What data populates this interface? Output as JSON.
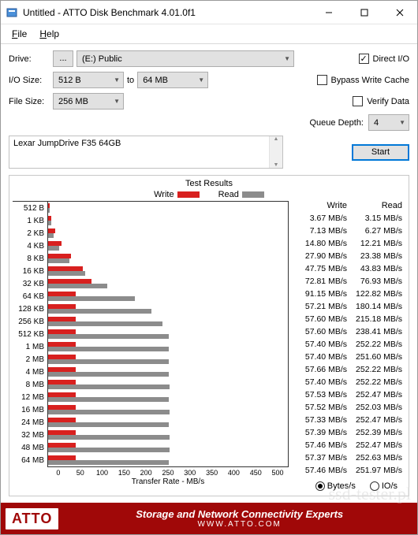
{
  "window": {
    "title": "Untitled - ATTO Disk Benchmark 4.01.0f1"
  },
  "menu": {
    "file": "File",
    "help": "Help"
  },
  "labels": {
    "drive": "Drive:",
    "iosize": "I/O Size:",
    "filesize": "File Size:",
    "to": "to",
    "queue_depth": "Queue Depth:",
    "direct_io": "Direct I/O",
    "bypass_cache": "Bypass Write Cache",
    "verify_data": "Verify Data",
    "start": "Start",
    "test_results": "Test Results",
    "write": "Write",
    "read": "Read",
    "xfer": "Transfer Rate - MB/s",
    "bytes_s": "Bytes/s",
    "io_s": "IO/s"
  },
  "form": {
    "drive_browse": "...",
    "drive_value": "(E:) Public",
    "io_min": "512 B",
    "io_max": "64 MB",
    "file_size": "256 MB",
    "queue_depth": "4",
    "direct_io_checked": true,
    "bypass_checked": false,
    "verify_checked": false,
    "description": "Lexar JumpDrive F35 64GB"
  },
  "chart_data": {
    "type": "bar",
    "title": "Test Results",
    "xlabel": "Transfer Rate - MB/s",
    "ylabel": "",
    "xlim": [
      0,
      500
    ],
    "xticks": [
      0,
      50,
      100,
      150,
      200,
      250,
      300,
      350,
      400,
      450,
      500
    ],
    "categories": [
      "512 B",
      "1 KB",
      "2 KB",
      "4 KB",
      "8 KB",
      "16 KB",
      "32 KB",
      "64 KB",
      "128 KB",
      "256 KB",
      "512 KB",
      "1 MB",
      "2 MB",
      "4 MB",
      "8 MB",
      "12 MB",
      "16 MB",
      "24 MB",
      "32 MB",
      "48 MB",
      "64 MB"
    ],
    "series": [
      {
        "name": "Write",
        "color": "#d8201f",
        "values": [
          3.67,
          7.13,
          14.8,
          27.9,
          47.75,
          72.81,
          91.15,
          57.21,
          57.6,
          57.6,
          57.4,
          57.4,
          57.66,
          57.4,
          57.53,
          57.52,
          57.33,
          57.39,
          57.46,
          57.37,
          57.46
        ]
      },
      {
        "name": "Read",
        "color": "#8c8c8c",
        "values": [
          3.15,
          6.27,
          12.21,
          23.38,
          43.83,
          76.93,
          122.82,
          180.14,
          215.18,
          238.41,
          252.22,
          251.6,
          252.22,
          252.22,
          252.47,
          252.03,
          252.47,
          252.39,
          252.47,
          252.63,
          251.97
        ]
      }
    ]
  },
  "unit_suffix": " MB/s",
  "footer": {
    "logo": "ATTO",
    "line1": "Storage and Network Connectivity Experts",
    "line2": "WWW.ATTO.COM"
  },
  "watermark": "ssd-tester.pl"
}
